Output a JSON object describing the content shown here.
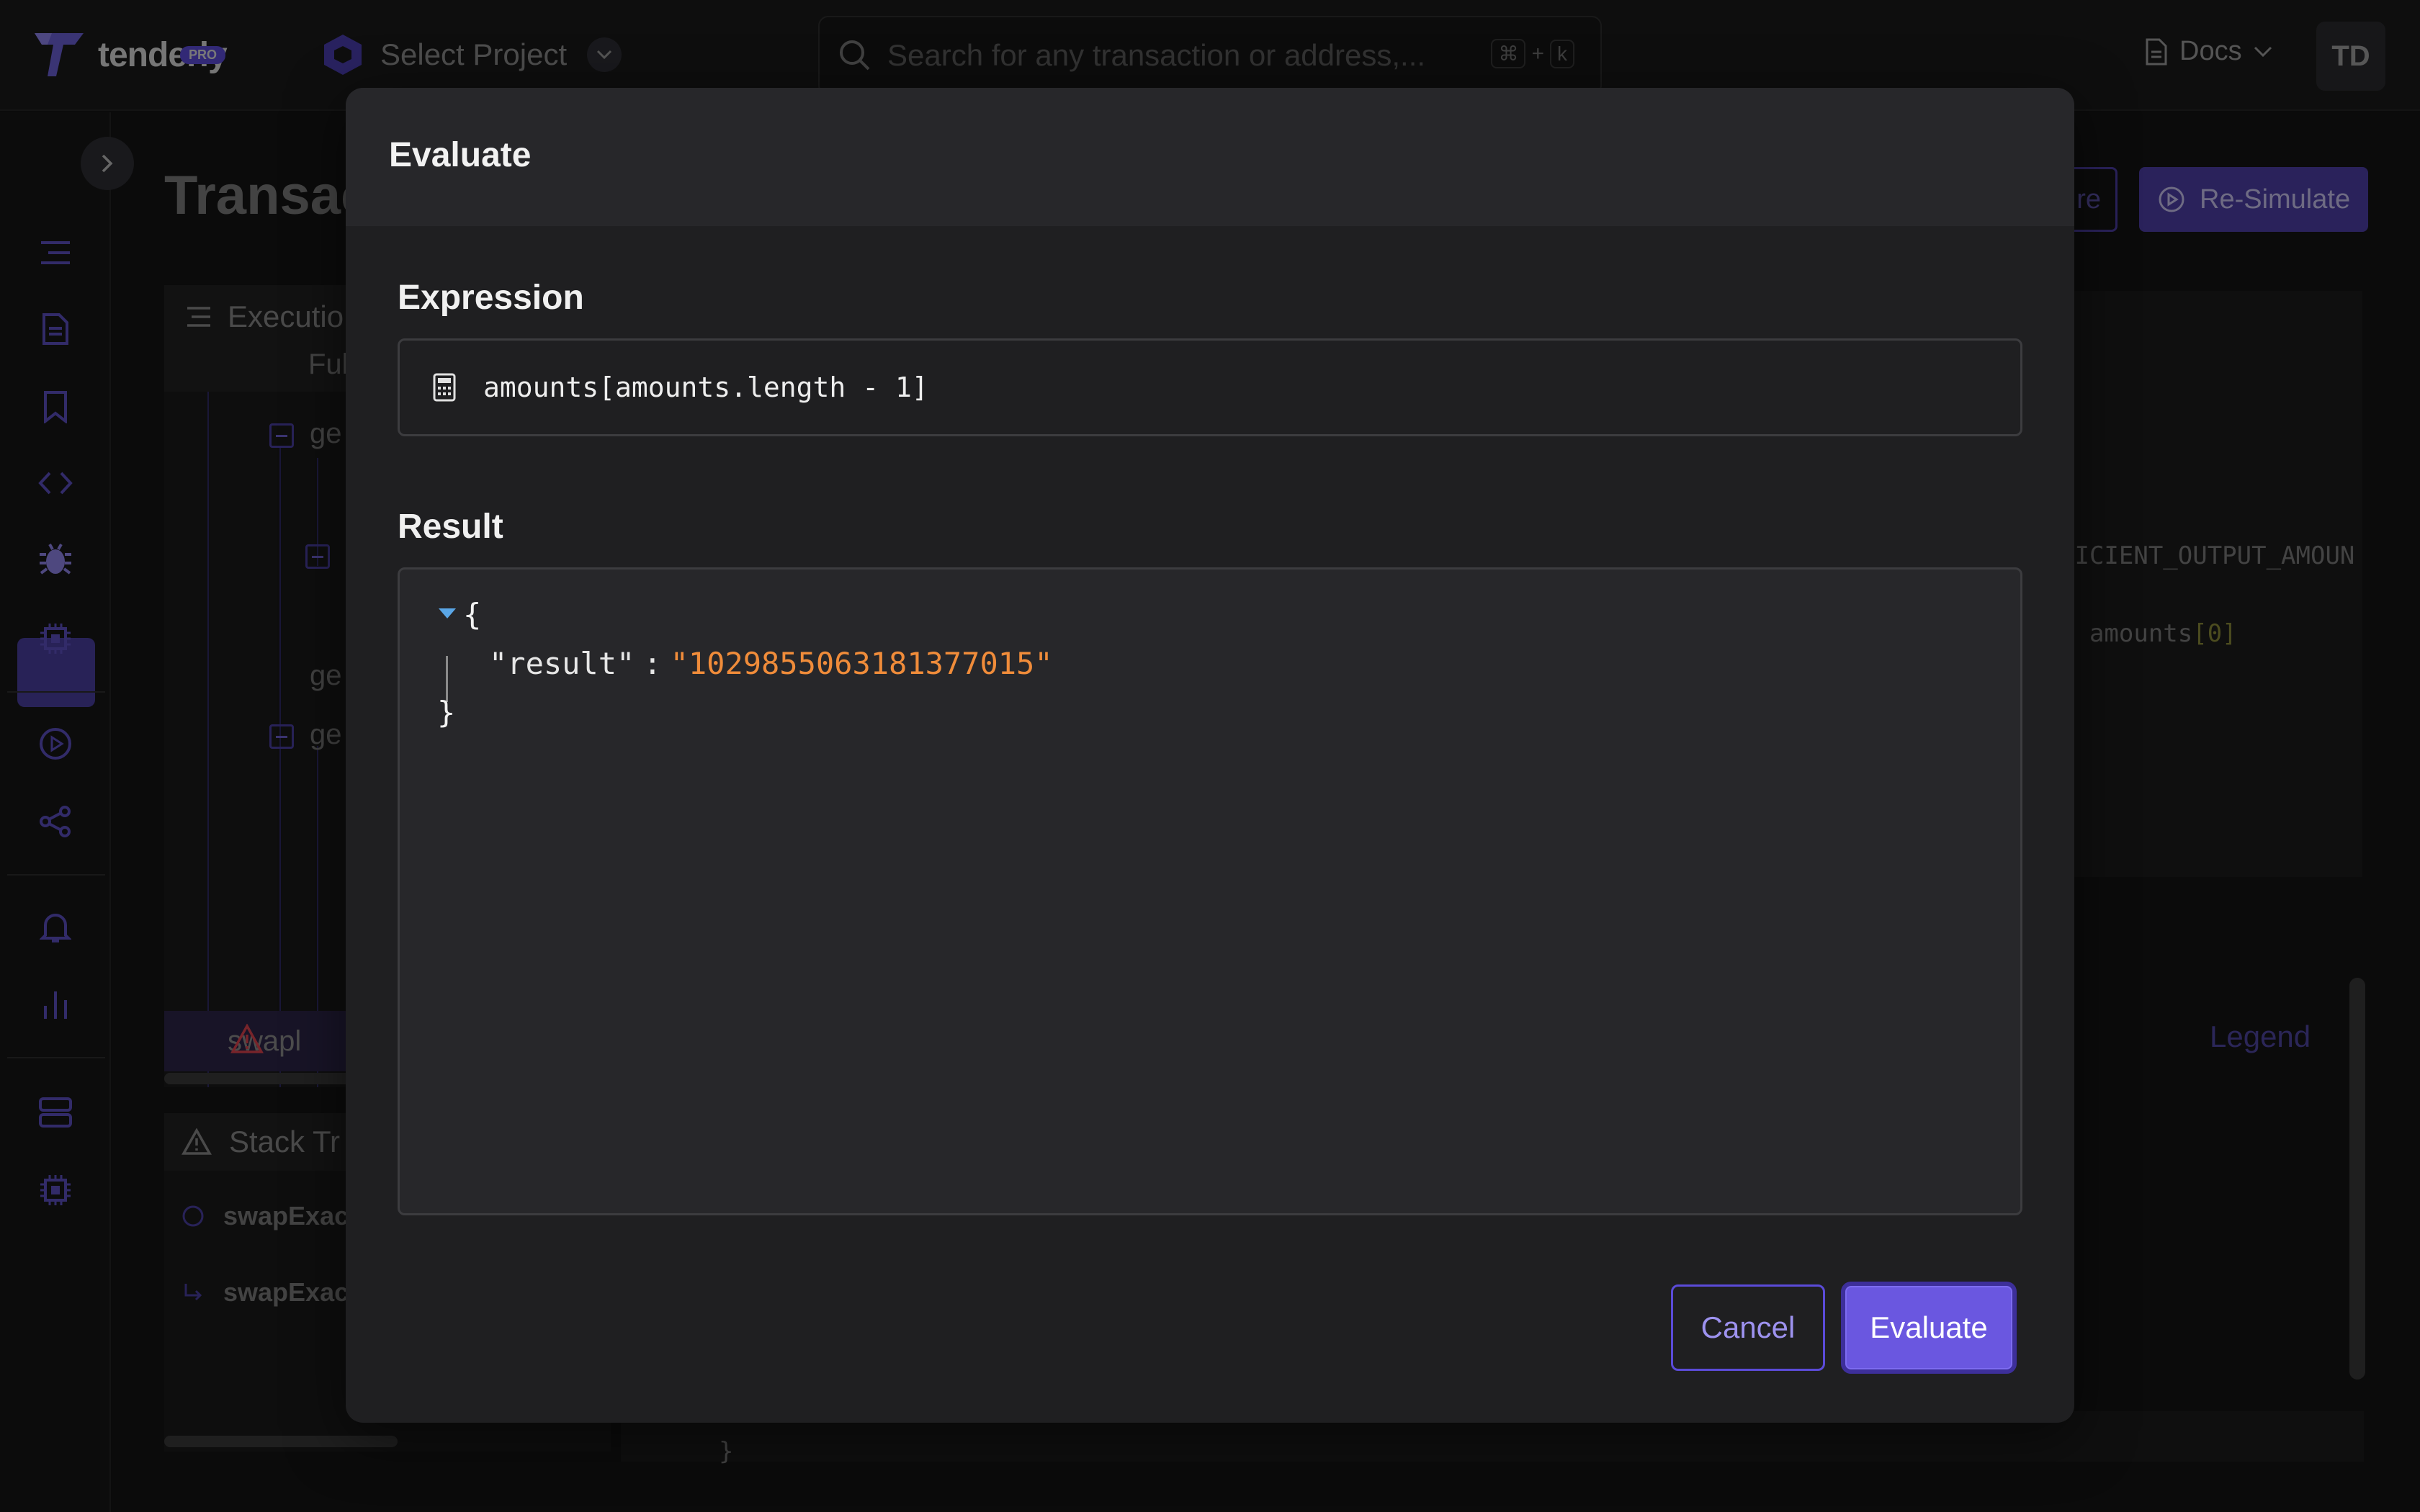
{
  "topbar": {
    "logo_text": "tenderly",
    "pro_badge": "PRO",
    "project_selector": "Select Project",
    "search_placeholder": "Search for any transaction or address,...",
    "shortcut_key1": "⌘",
    "shortcut_plus": "+",
    "shortcut_key2": "k",
    "docs_label": "Docs",
    "avatar_initials": "TD"
  },
  "page": {
    "title": "Transac",
    "compare_label": "re",
    "resimulate_label": "Re-Simulate",
    "legend_label": "Legend"
  },
  "execution_panel": {
    "title": "Executio",
    "view_label": "Ful",
    "rows": [
      "ge",
      "ge",
      "ge"
    ],
    "error_row": "swapl"
  },
  "stack_panel": {
    "title": "Stack Tr",
    "items": [
      "swapExac",
      "swapExac"
    ]
  },
  "code_panel": {
    "line1": "FICIENT_OUTPUT_AMOUN",
    "line2_prefix": ", amounts",
    "line2_index": "[0]",
    "bottom_brace": "}"
  },
  "modal": {
    "title": "Evaluate",
    "expression_label": "Expression",
    "expression_value": "amounts[amounts.length - 1]",
    "result_label": "Result",
    "result": {
      "open_brace": "{",
      "key": "\"result\"",
      "colon": ":",
      "value": "\"1029855063181377015\"",
      "close_brace": "}"
    },
    "cancel_label": "Cancel",
    "evaluate_label": "Evaluate"
  },
  "colors": {
    "accent": "#6a57e0",
    "json_string": "#f08c3a",
    "modal_bg": "#1f1f21"
  }
}
